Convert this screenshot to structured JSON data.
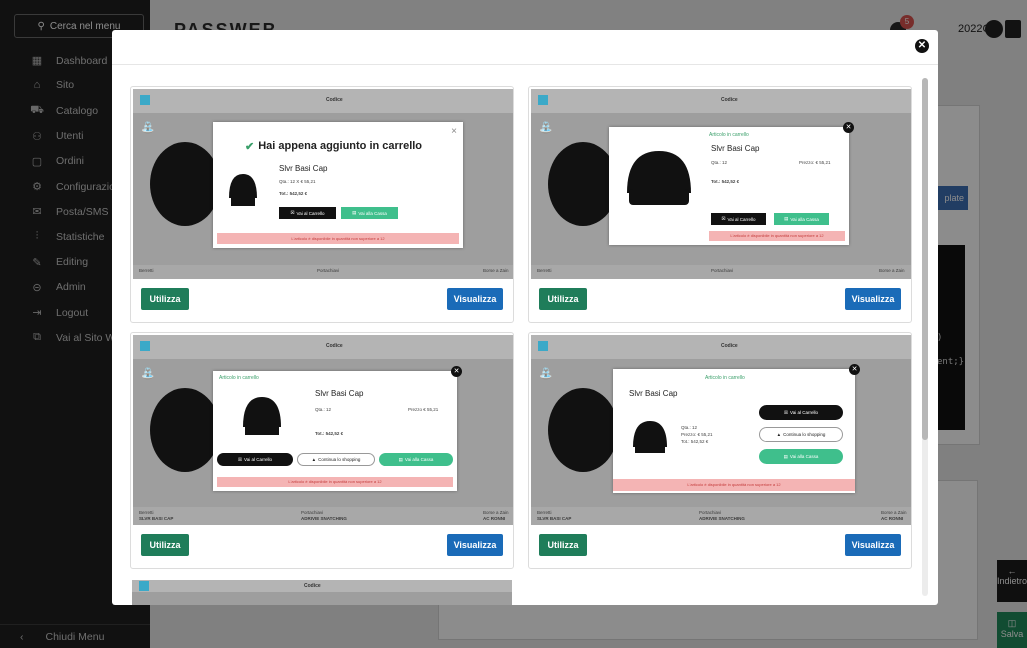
{
  "sidebar": {
    "search_label": "Cerca nel menu",
    "items": [
      {
        "label": "Dashboard",
        "icon": "dashboard-icon",
        "glyph": "▦"
      },
      {
        "label": "Sito",
        "icon": "home-icon",
        "glyph": "⌂"
      },
      {
        "label": "Catalogo",
        "icon": "cart-icon",
        "glyph": "⛟"
      },
      {
        "label": "Utenti",
        "icon": "users-icon",
        "glyph": "⚇"
      },
      {
        "label": "Ordini",
        "icon": "orders-icon",
        "glyph": "▢"
      },
      {
        "label": "Configurazioni",
        "icon": "gear-icon",
        "glyph": "⚙"
      },
      {
        "label": "Posta/SMS",
        "icon": "mail-icon",
        "glyph": "✉"
      },
      {
        "label": "Statistiche",
        "icon": "stats-icon",
        "glyph": "⫶"
      },
      {
        "label": "Editing",
        "icon": "pencil-icon",
        "glyph": "✎"
      },
      {
        "label": "Admin",
        "icon": "lock-icon",
        "glyph": "⊝"
      },
      {
        "label": "Logout",
        "icon": "logout-icon",
        "glyph": "⇥"
      },
      {
        "label": "Vai al Sito Web",
        "icon": "external-link-icon",
        "glyph": "⧉"
      }
    ],
    "footer_label": "Chiudi Menu"
  },
  "topbar": {
    "brand": "PASSWEB",
    "notification_count": "5",
    "year_label": "2022C"
  },
  "background": {
    "template_button": "plate",
    "code_line_1": ")",
    "code_line_2": "ent;}",
    "back_button": "Indietro",
    "save_button": "Salva"
  },
  "modal": {
    "cards": [
      {
        "use_label": "Utilizza",
        "view_label": "Visualizza",
        "thumb_header": "Codice",
        "popup": {
          "title": "Hai appena aggiunto in carrello",
          "product": "Slvr Basi Cap",
          "qty": "Qta.: 12 X € 55,21",
          "total": "Tot.: 542,52 €",
          "cart_button": "Vai al Carrello",
          "checkout_button": "Vai alla Cassa",
          "warning": "L'articolo è disponibile in quantità non superiore a 12"
        },
        "footer_cols": [
          "Berretti",
          "Portachiavi",
          "Borse a Zain"
        ]
      },
      {
        "use_label": "Utilizza",
        "view_label": "Visualizza",
        "thumb_header": "Codice",
        "popup": {
          "added": "Articolo in carrello",
          "product": "Slvr Basi Cap",
          "qty_label": "Qta.: 12",
          "price_label": "Prezzo: € 55,21",
          "total": "Tot.: 542,52 €",
          "cart_button": "Vai al Carrello",
          "checkout_button": "Vai alla Cassa",
          "warning": "L'articolo è disponibile in quantità non superiore a 12"
        },
        "footer_cols": [
          "Berretti",
          "Portachiavi",
          "Borse a Zain"
        ]
      },
      {
        "use_label": "Utilizza",
        "view_label": "Visualizza",
        "thumb_header": "Codice",
        "popup": {
          "added": "Articolo in carrello",
          "product": "Slvr Basi Cap",
          "qty_label": "Qta.: 12",
          "price_label": "Prezzo € 55,21",
          "total": "Tot.: 542,52 €",
          "cart_button": "Vai al Carrello",
          "continue_button": "Continua lo shopping",
          "checkout_button": "Vai alla Cassa",
          "warning": "L'articolo è disponibile in quantità non superiore a 12"
        },
        "footer_cols": [
          "Berretti",
          "Portachiavi",
          "Borse a Zain"
        ],
        "footer_sub": [
          "SLVR BASI CAP",
          "ADRIVIE SNATCHING",
          "AC RONNI"
        ]
      },
      {
        "use_label": "Utilizza",
        "view_label": "Visualizza",
        "thumb_header": "Codice",
        "popup": {
          "added": "Articolo in carrello",
          "product": "Slvr Basi Cap",
          "qty_label": "Qta.: 12",
          "price_label": "Prezzo: € 55,21",
          "total": "Tot.: 542,52 €",
          "cart_button": "Vai al Carrello",
          "continue_button": "Continua lo shopping",
          "checkout_button": "Vai alla Cassa",
          "warning": "L'articolo è disponibile in quantità non superiore a 12"
        },
        "footer_cols": [
          "Berretti",
          "Portachiavi",
          "Borse a Zain"
        ],
        "footer_sub": [
          "SLVR BASI CAP",
          "ADRIVIE SNATCHING",
          "AC RONNI"
        ]
      }
    ],
    "partial_thumb_header": "Codice"
  },
  "colors": {
    "utilizza": "#1f7d5a",
    "visualizza": "#1a6bb8",
    "sidebar": "#1f1f1f",
    "accent_green": "#3a9f6a"
  }
}
